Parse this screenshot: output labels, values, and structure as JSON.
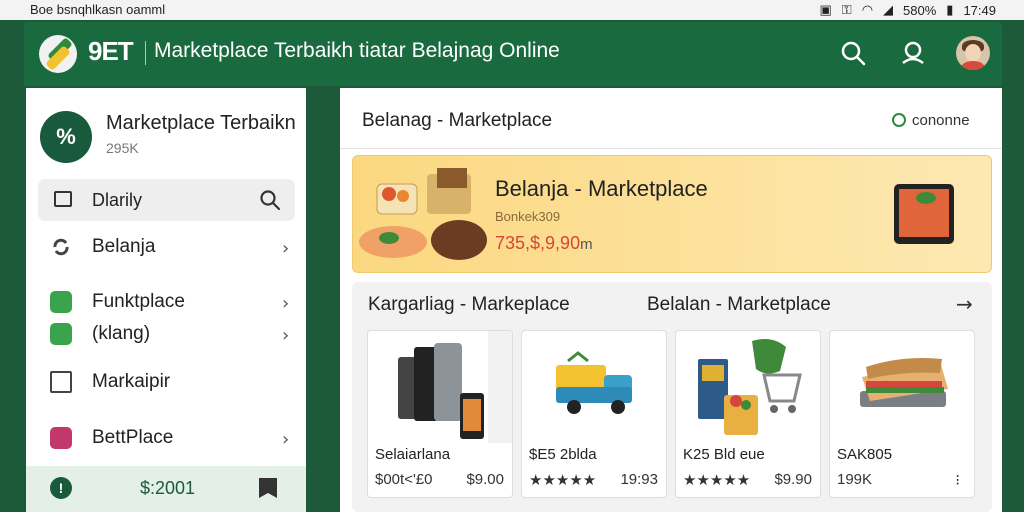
{
  "status": {
    "left_text": "Boe bsnqhlkasn oamml",
    "battery": "580%",
    "time": "17:49"
  },
  "header": {
    "brand": "9ET",
    "title": "Marketplace Terbaikh tiatar Belajnag Online"
  },
  "sidebar": {
    "logo_text": "%",
    "title": "Marketplace Terbaikn",
    "subtitle": "295K",
    "search_label": "Dlarily",
    "items": [
      {
        "label": "Belanja",
        "icon": "refresh-icon",
        "color": "#444444"
      },
      {
        "label": "Funktplace",
        "icon": "leaf-icon",
        "color": "#3aa34b"
      },
      {
        "label": "(klang)",
        "icon": "tag-icon",
        "color": "#3aa34b"
      },
      {
        "label": "Markaipir",
        "icon": "bag-icon",
        "color": "#444444"
      },
      {
        "label": "BettPlace",
        "icon": "camera-icon",
        "color": "#c2386b"
      }
    ],
    "footer_amount": "$:2001"
  },
  "main": {
    "heading": "Belanag - Marketplace",
    "online_label": "cononne",
    "banner": {
      "title": "Belanja - Marketplace",
      "subtitle": "Bonkek309",
      "price": "735,$,9,90",
      "price_unit": "m"
    },
    "section_left": "Kargarliag - Markeplace",
    "section_right": "Belalan - Marketplace",
    "products": [
      {
        "name": "Selaiarlana",
        "meta": "$00t<'£0",
        "price": "$9.00",
        "image": "phones"
      },
      {
        "name": "$E5 2blda",
        "meta": "★★★★★",
        "price": "19:93",
        "image": "truck"
      },
      {
        "name": "K25 Bld eue",
        "meta": "★★★★★",
        "price": "$9.90",
        "image": "cart"
      },
      {
        "name": "SAK805",
        "meta": "199K",
        "price": "⁝",
        "image": "sandwich"
      }
    ]
  },
  "colors": {
    "accent": "#1a6a40",
    "banner": "#fbd880",
    "price": "#d6463c",
    "star": "#f0b323"
  }
}
